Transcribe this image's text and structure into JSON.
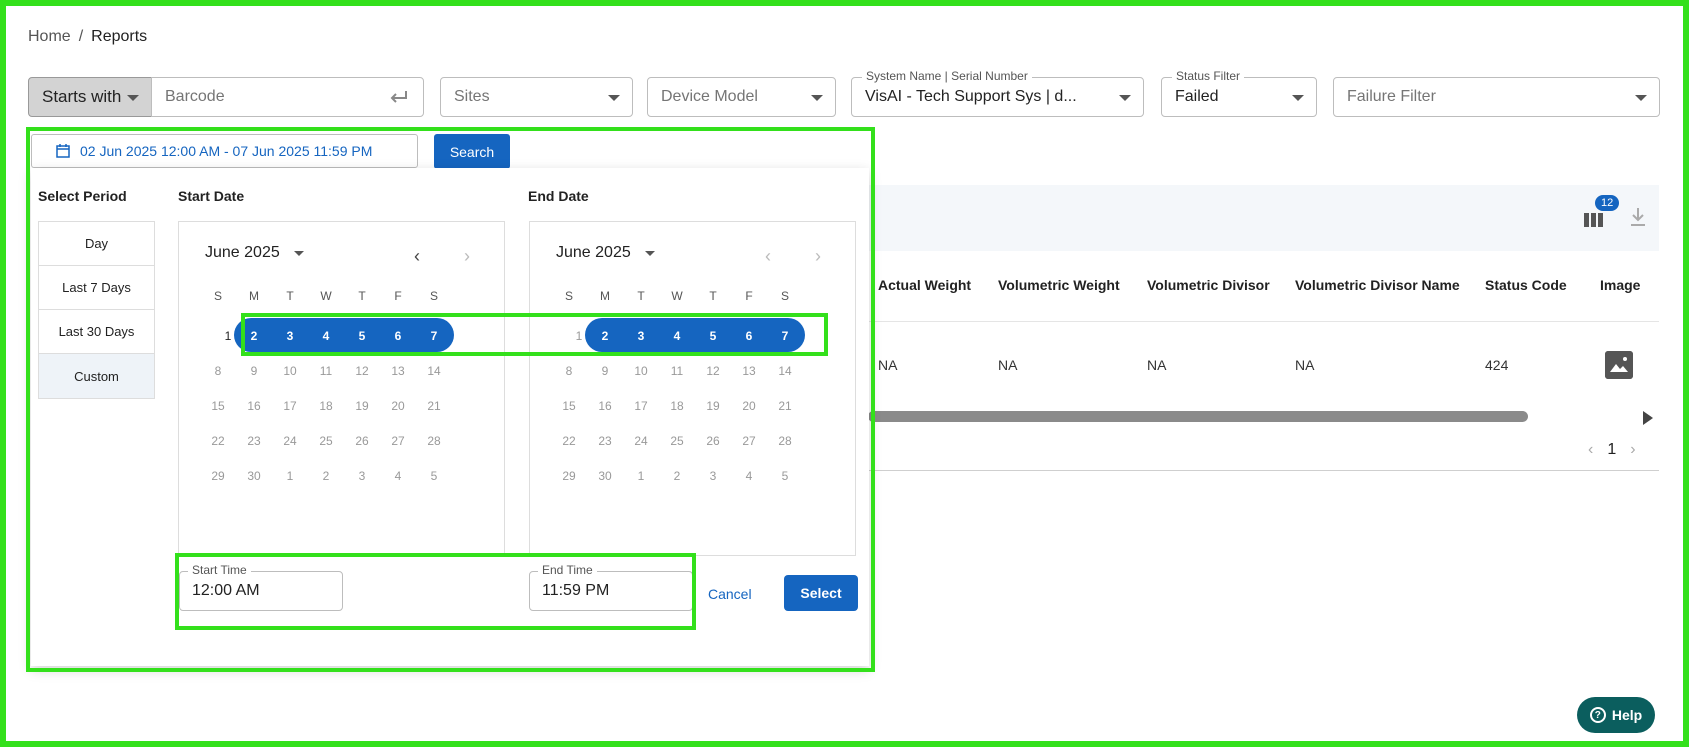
{
  "breadcrumb": {
    "home": "Home",
    "separator": "/",
    "current": "Reports"
  },
  "filters": {
    "starts_with": "Starts with",
    "barcode_placeholder": "Barcode",
    "sites": "Sites",
    "device_model": "Device Model",
    "system_label": "System Name | Serial Number",
    "system_value": "VisAI - Tech Support Sys | d...",
    "status_label": "Status Filter",
    "status_value": "Failed",
    "failure_filter": "Failure Filter"
  },
  "date_range": "02 Jun 2025 12:00 AM - 07 Jun 2025 11:59 PM",
  "search_label": "Search",
  "table": {
    "badge_count": "12",
    "headers": [
      "Actual Weight",
      "Volumetric Weight",
      "Volumetric Divisor",
      "Volumetric Divisor Name",
      "Status Code",
      "Image"
    ],
    "row": [
      "NA",
      "NA",
      "NA",
      "NA",
      "424"
    ],
    "page": "1"
  },
  "picker": {
    "select_period": "Select Period",
    "periods": [
      "Day",
      "Last 7 Days",
      "Last 30 Days",
      "Custom"
    ],
    "start_title": "Start Date",
    "end_title": "End Date",
    "start_month": "June 2025",
    "end_month": "June 2025",
    "weekdays": [
      "S",
      "M",
      "T",
      "W",
      "T",
      "F",
      "S"
    ],
    "weeks": [
      [
        "",
        "1",
        "2",
        "3",
        "4",
        "5",
        "6",
        "7"
      ],
      [
        "8",
        "9",
        "10",
        "11",
        "12",
        "13",
        "14"
      ],
      [
        "15",
        "16",
        "17",
        "18",
        "19",
        "20",
        "21"
      ],
      [
        "22",
        "23",
        "24",
        "25",
        "26",
        "27",
        "28"
      ],
      [
        "29",
        "30",
        "1",
        "2",
        "3",
        "4",
        "5"
      ]
    ],
    "start_time_label": "Start Time",
    "start_time": "12:00 AM",
    "end_time_label": "End Time",
    "end_time": "11:59 PM",
    "cancel": "Cancel",
    "select": "Select"
  },
  "help": "Help"
}
